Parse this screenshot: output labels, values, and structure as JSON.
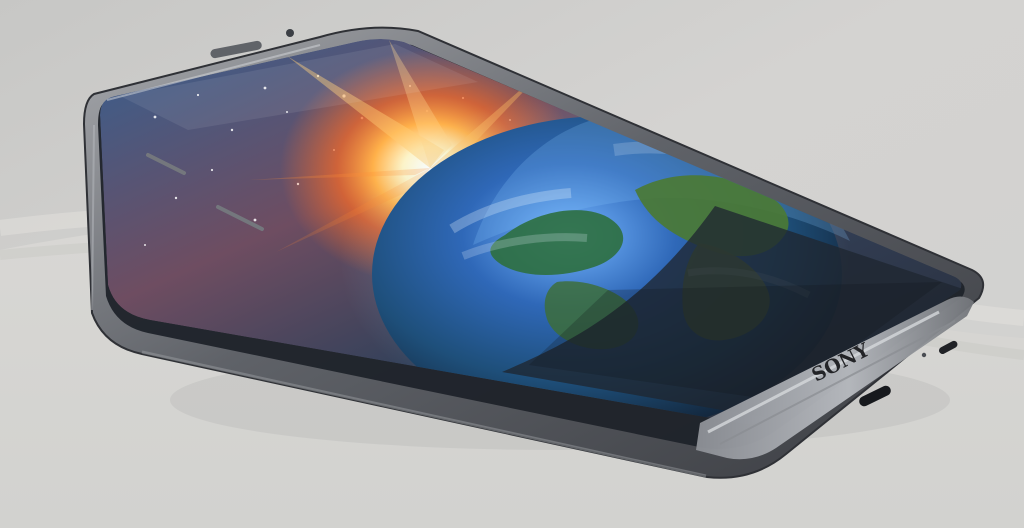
{
  "image": {
    "brand_text": "SONY",
    "colors": {
      "background": "#cfcfcd",
      "phone_frame": "#5b5d63",
      "screen_dark": "#303847",
      "sun_flare": "#ff9a3a",
      "earth_ocean": "#2f68b8"
    }
  }
}
